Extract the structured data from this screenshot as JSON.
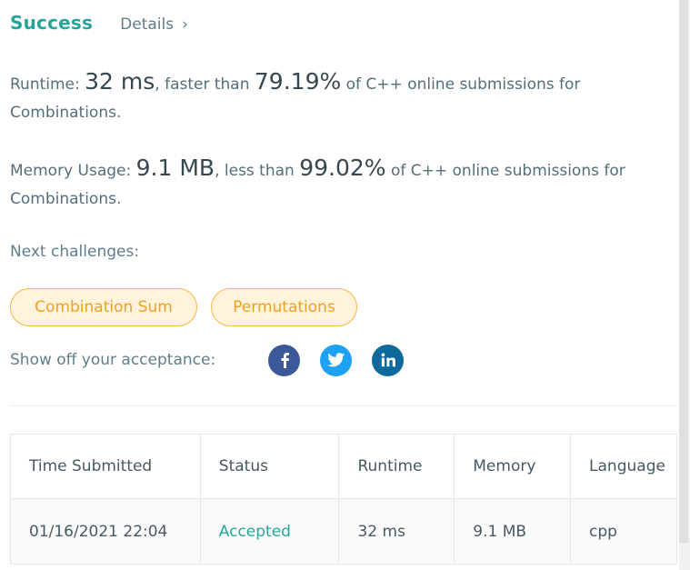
{
  "header": {
    "status": "Success",
    "details_label": "Details",
    "chevron_glyph": "›"
  },
  "runtime": {
    "label": "Runtime: ",
    "value": "32 ms",
    "comparison": ", faster than ",
    "percent": "79.19%",
    "suffix": " of C++ online submissions for Combinations."
  },
  "memory": {
    "label": "Memory Usage: ",
    "value": "9.1 MB",
    "comparison": ", less than ",
    "percent": "99.02%",
    "suffix": " of C++ online submissions for Combinations."
  },
  "next": {
    "label": "Next challenges:",
    "challenges": [
      "Combination Sum",
      "Permutations"
    ]
  },
  "share": {
    "label": "Show off your acceptance:",
    "icons": [
      "facebook-icon",
      "twitter-icon",
      "linkedin-icon"
    ]
  },
  "table": {
    "headers": [
      "Time Submitted",
      "Status",
      "Runtime",
      "Memory",
      "Language"
    ],
    "rows": [
      [
        "01/16/2021 22:04",
        "Accepted",
        "32 ms",
        "9.1 MB",
        "cpp"
      ]
    ]
  },
  "colors": {
    "success": "#26a69a",
    "tag_border": "#f5b841",
    "tag_bg": "#fff3dc",
    "tag_text": "#f0a022",
    "facebook": "#3b5998",
    "twitter": "#1da1f2",
    "linkedin": "#0e6a9c"
  }
}
